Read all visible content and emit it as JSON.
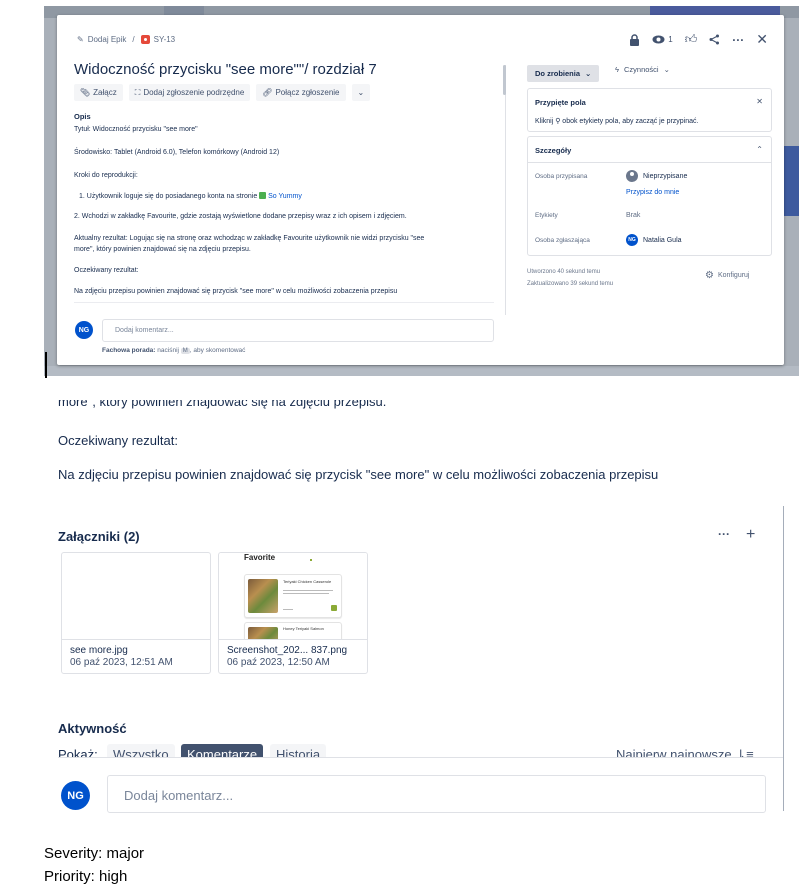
{
  "modal": {
    "breadcrumb": {
      "add_epic": "Dodaj Epik",
      "separator": "/",
      "issue_key": "SY-13"
    },
    "watchers_count": "1",
    "title": "Widoczność przycisku \"see more\"\"/ rozdział 7",
    "toolbar": {
      "attach": "Załącz",
      "add_child": "Dodaj zgłoszenie podrzędne",
      "link_issue": "Połącz zgłoszenie"
    },
    "description": {
      "heading": "Opis",
      "line_title": "Tytuł: Widoczność przycisku \"see more\"",
      "line_env": "Środowisko: Tablet (Android 6.0), Telefon komórkowy (Android 12)",
      "steps_heading": "Kroki do reprodukcji:",
      "step1_text": "1. Użytkownik loguje się do posiadanego konta na stronie",
      "step1_link": "So Yummy",
      "step2": "2. Wchodzi w zakładkę Favourite, gdzie zostają wyświetlone dodane przepisy wraz z ich opisem i zdjęciem.",
      "actual_1": "Aktualny rezultat: Logując się na stronę oraz wchodząc w zakładkę Favourite użytkownik nie widzi przycisku \"see",
      "actual_2": "more\", który powinien znajdować się na zdjęciu przepisu.",
      "expected_heading": "Oczekiwany rezultat:",
      "expected": "Na zdjęciu przepisu powinien znajdować się przycisk \"see more\" w celu możliwości zobaczenia przepisu"
    },
    "comment": {
      "avatar": "NG",
      "placeholder": "Dodaj komentarz...",
      "tip_bold": "Fachowa porada:",
      "tip_text": "naciśnij",
      "tip_key": "M",
      "tip_end": ", aby skomentować"
    },
    "status": "Do zrobienia",
    "actions": "Czynności",
    "pinned": {
      "title": "Przypięte pola",
      "text": "Kliknij ⚲ obok etykiety pola, aby zacząć je przypinać."
    },
    "details": {
      "title": "Szczegóły",
      "assignee_label": "Osoba przypisana",
      "assignee_value": "Nieprzypisane",
      "assign_me": "Przypisz do mnie",
      "labels_label": "Etykiety",
      "labels_value": "Brak",
      "reporter_label": "Osoba zgłaszająca",
      "reporter_avatar": "NG",
      "reporter_value": "Natalia Gula"
    },
    "created": "Utworzono 40 sekund temu",
    "updated": "Zaktualizowano 39 sekund temu",
    "configure": "Konfiguruj"
  },
  "page": {
    "partial_line": "more\", który powinien znajdować się na zdjęciu przepisu.",
    "expected_heading": "Oczekiwany rezultat:",
    "expected": "Na zdjęciu przepisu powinien znajdować się przycisk \"see more\" w celu możliwości zobaczenia przepisu",
    "attachments": {
      "heading": "Załączniki (2)",
      "items": [
        {
          "name": "see more.jpg",
          "date": "06 paź 2023, 12:51 AM"
        },
        {
          "name": "Screenshot_202... 837.png",
          "date": "06 paź 2023, 12:50 AM"
        }
      ],
      "thumb": {
        "title": "Favorite",
        "recipe1": "Teriyaki Chicken Casserole",
        "recipe2": "Honey Teriyaki Salmon"
      }
    },
    "activity": {
      "heading": "Aktywność",
      "show_label": "Pokaż:",
      "tabs": [
        "Wszystko",
        "Komentarze",
        "Historia"
      ],
      "active_tab": "Komentarze",
      "sort": "Najpierw najnowsze"
    },
    "comment": {
      "avatar": "NG",
      "placeholder": "Dodaj komentarz..."
    }
  },
  "meta": {
    "severity": "Severity: major",
    "priority": "Priority: high"
  },
  "colors": {
    "accent": "#0052cc",
    "bug": "#e5493a",
    "active_tab": "#42526e"
  }
}
